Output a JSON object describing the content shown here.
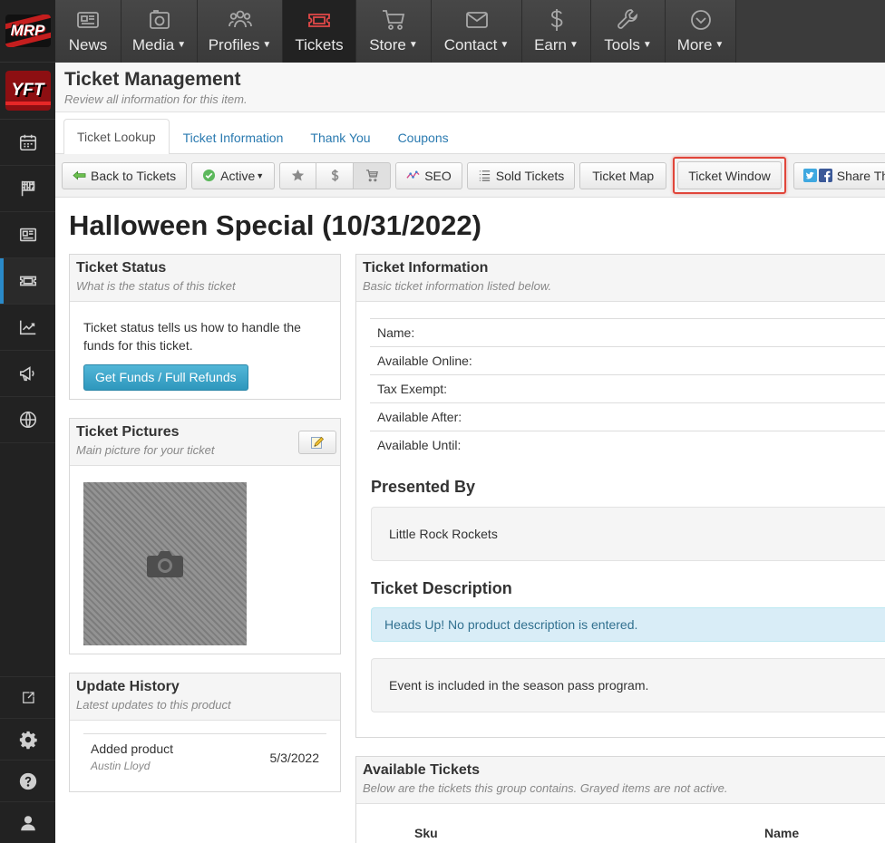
{
  "brand": {
    "logo_primary": "MRP",
    "logo_secondary": "YFT"
  },
  "colors": {
    "accent": "#2a8ac9",
    "nav_active_icon": "#e24848",
    "highlight_border": "#e0453a",
    "info_button": "#3da5c9"
  },
  "topnav": {
    "items": [
      {
        "label": "News",
        "icon": "newspaper-icon",
        "caret": false
      },
      {
        "label": "Media",
        "icon": "camera-icon",
        "caret": true
      },
      {
        "label": "Profiles",
        "icon": "users-icon",
        "caret": true
      },
      {
        "label": "Tickets",
        "icon": "ticket-icon",
        "caret": false,
        "active": true
      },
      {
        "label": "Store",
        "icon": "cart-icon",
        "caret": true
      },
      {
        "label": "Contact",
        "icon": "envelope-icon",
        "caret": true
      },
      {
        "label": "Earn",
        "icon": "dollar-icon",
        "caret": true
      },
      {
        "label": "Tools",
        "icon": "wrench-icon",
        "caret": true
      },
      {
        "label": "More",
        "icon": "chevron-circle-icon",
        "caret": true
      }
    ]
  },
  "sidebar": {
    "items": [
      {
        "icon": "calendar-icon"
      },
      {
        "icon": "checkered-flag-icon"
      },
      {
        "icon": "newspaper-icon"
      },
      {
        "icon": "ticket-icon",
        "active": true
      },
      {
        "icon": "trending-chart-icon"
      },
      {
        "icon": "megaphone-icon"
      },
      {
        "icon": "globe-icon"
      }
    ],
    "bottom_items": [
      {
        "icon": "external-link-icon"
      },
      {
        "icon": "gear-icon"
      },
      {
        "icon": "help-icon"
      },
      {
        "icon": "user-icon"
      }
    ]
  },
  "header": {
    "title": "Ticket Management",
    "subtitle": "Review all information for this item."
  },
  "tabs": [
    {
      "label": "Ticket Lookup",
      "active": true
    },
    {
      "label": "Ticket Information"
    },
    {
      "label": "Thank You"
    },
    {
      "label": "Coupons"
    }
  ],
  "toolbar": {
    "back_label": "Back to Tickets",
    "active_label": "Active",
    "seo_label": "SEO",
    "sold_label": "Sold Tickets",
    "map_label": "Ticket Map",
    "window_label": "Ticket Window",
    "share_label": "Share This"
  },
  "ticket": {
    "title": "Halloween Special (10/31/2022)"
  },
  "status_panel": {
    "title": "Ticket Status",
    "subtitle": "What is the status of this ticket",
    "body": "Ticket status tells us how to handle the funds for this ticket.",
    "button": "Get Funds / Full Refunds"
  },
  "pictures_panel": {
    "title": "Ticket Pictures",
    "subtitle": "Main picture for your ticket"
  },
  "history_panel": {
    "title": "Update History",
    "subtitle": "Latest updates to this product",
    "entries": [
      {
        "action": "Added product",
        "user": "Austin Lloyd",
        "date": "5/3/2022"
      }
    ]
  },
  "info_panel": {
    "title": "Ticket Information",
    "subtitle": "Basic ticket information listed below.",
    "rows": [
      "Name:",
      "Available Online:",
      "Tax Exempt:",
      "Available After:",
      "Available Until:"
    ],
    "presented_by_heading": "Presented By",
    "presented_by": "Little Rock Rockets",
    "description_heading": "Ticket Description",
    "description_alert": "Heads Up! No product description is entered.",
    "season_note": "Event is included in the season pass program."
  },
  "available_panel": {
    "title": "Available Tickets",
    "subtitle": "Below are the tickets this group contains. Grayed items are not active.",
    "columns": [
      "Sku",
      "Name"
    ]
  }
}
